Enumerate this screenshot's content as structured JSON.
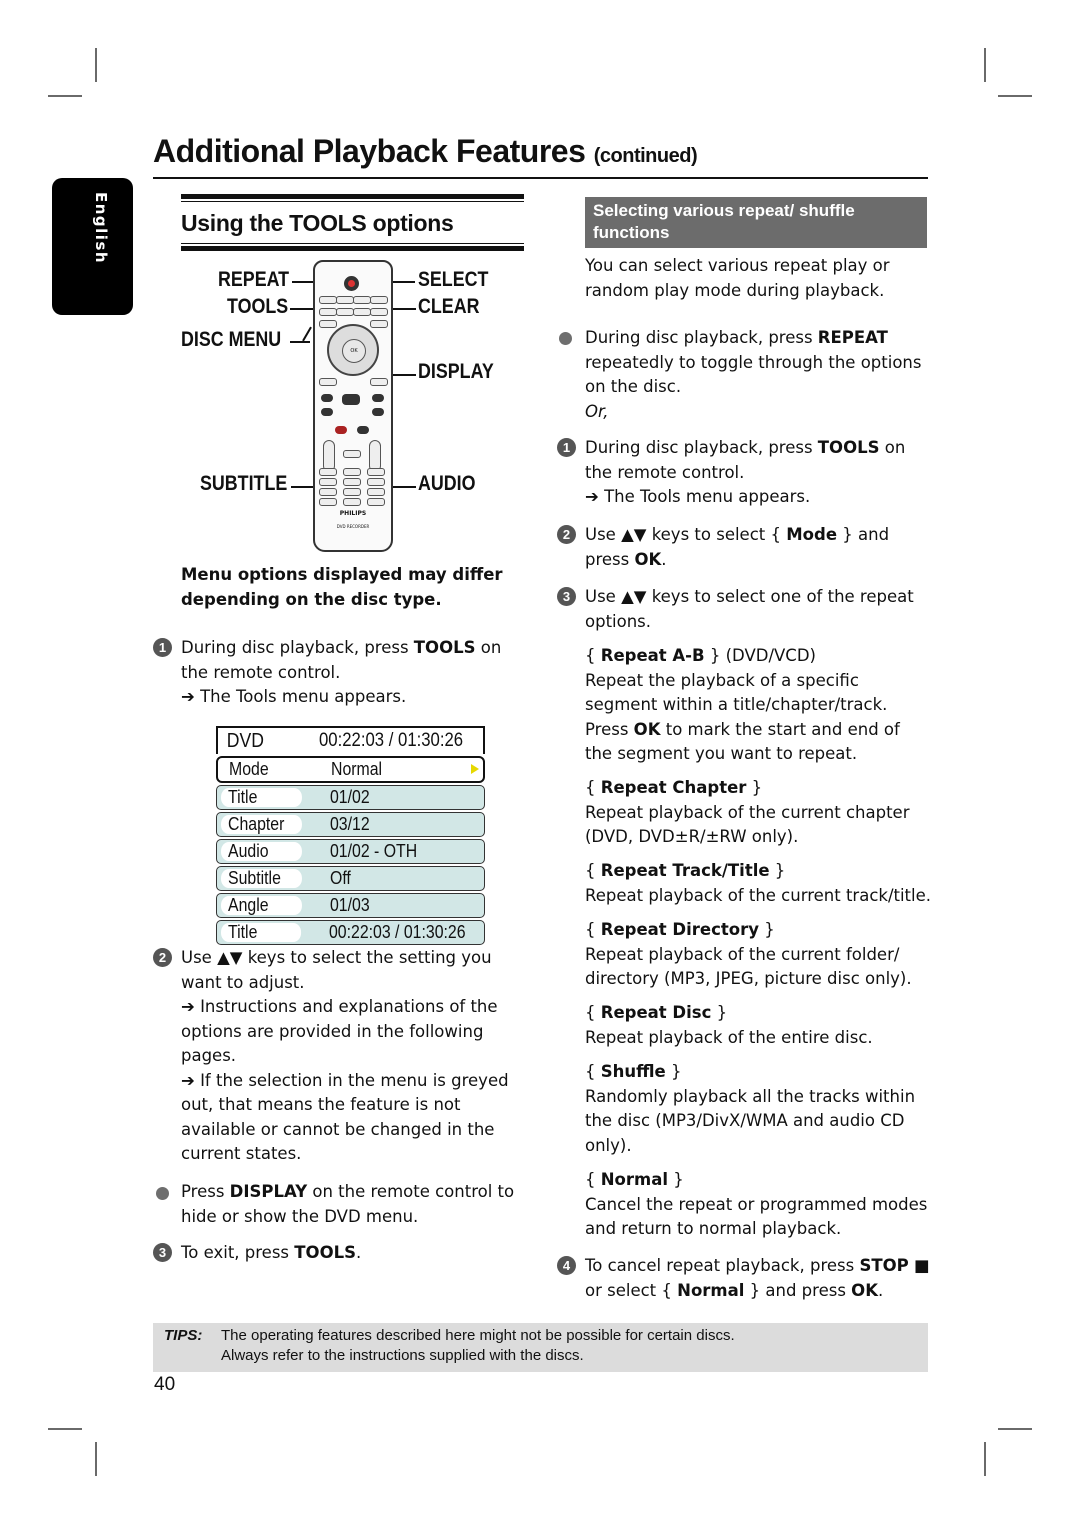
{
  "header": {
    "title": "Additional Playback Features",
    "title_suffix": "(continued)",
    "language_tab": "English"
  },
  "left": {
    "section_title": "Using the TOOLS options",
    "remote_labels": {
      "repeat": "REPEAT",
      "tools": "TOOLS",
      "disc_menu": "DISC MENU",
      "select": "SELECT",
      "clear": "CLEAR",
      "display": "DISPLAY",
      "subtitle": "SUBTITLE",
      "audio": "AUDIO"
    },
    "remote_brand": "PHILIPS",
    "remote_model": "DVD RECORDER",
    "remote_ok": "OK",
    "note": "Menu options displayed may differ depending on the disc type.",
    "step1": {
      "num": "1",
      "pre": "During disc playback, press ",
      "key": "TOOLS",
      "post": " on the remote control.",
      "result": "➔ The Tools menu appears."
    },
    "tools_menu": {
      "header_label": "DVD",
      "header_value": "00:22:03 / 01:30:26",
      "rows": [
        {
          "label": "Mode",
          "value": "Normal"
        },
        {
          "label": "Title",
          "value": "01/02"
        },
        {
          "label": "Chapter",
          "value": "03/12"
        },
        {
          "label": "Audio",
          "value": "01/02 - OTH"
        },
        {
          "label": "Subtitle",
          "value": "Off"
        },
        {
          "label": "Angle",
          "value": "01/03"
        },
        {
          "label": "Title",
          "value": "00:22:03 / 01:30:26"
        }
      ],
      "selected_highlight_color": "#ffffff",
      "row_color": "#d2e7e6",
      "arrow_color": "#e6d800"
    },
    "step2": {
      "num": "2",
      "text": "Use ▲▼ keys to select the setting you want to adjust.",
      "result1": "➔ Instructions and explanations of the options are provided in the following pages.",
      "result2": "➔ If the selection in the menu is greyed out, that means the feature is not available or cannot be changed in the current states."
    },
    "bullet": {
      "pre": "Press ",
      "key": "DISPLAY",
      "post": " on the remote control to hide or show the DVD menu."
    },
    "step3": {
      "num": "3",
      "pre": "To exit, press ",
      "key": "TOOLS",
      "post": "."
    }
  },
  "right": {
    "section_title": "Selecting various repeat/ shuffle functions",
    "intro": "You can select various repeat play or random play mode during playback.",
    "bullet": {
      "pre": "During disc playback, press ",
      "key": "REPEAT",
      "post": " repeatedly to toggle through the options on the disc.",
      "or": "Or,"
    },
    "step1": {
      "num": "1",
      "pre": "During disc playback, press ",
      "key": "TOOLS",
      "post": " on the remote control.",
      "result": "➔ The Tools menu appears."
    },
    "step2": {
      "num": "2",
      "pre": "Use ▲▼ keys to select { ",
      "key": "Mode",
      "mid": " } and press ",
      "key2": "OK",
      "post": "."
    },
    "step3": {
      "num": "3",
      "text": "Use ▲▼ keys to select one of the repeat options."
    },
    "options": [
      {
        "name": "Repeat A-B",
        "suffix": " (DVD/VCD)",
        "desc_pre": "Repeat the playback of a specific segment within a title/chapter/track. Press ",
        "desc_key": "OK",
        "desc_post": " to mark the start and end of the segment you want to repeat."
      },
      {
        "name": "Repeat Chapter",
        "suffix": "",
        "desc": "Repeat playback of the current chapter (DVD, DVD±R/±RW only)."
      },
      {
        "name": "Repeat Track/Title",
        "suffix": "",
        "desc": "Repeat playback of the current track/title."
      },
      {
        "name": "Repeat Directory",
        "suffix": "",
        "desc": "Repeat playback of the current folder/ directory (MP3, JPEG, picture disc only)."
      },
      {
        "name": "Repeat Disc",
        "suffix": "",
        "desc": "Repeat playback of the entire disc."
      },
      {
        "name": "Shuffle",
        "suffix": "",
        "desc": "Randomly playback all the tracks within the disc (MP3/DivX/WMA and audio CD only)."
      },
      {
        "name": "Normal",
        "suffix": "",
        "desc": "Cancel the repeat or programmed modes and return to normal playback."
      }
    ],
    "step4": {
      "num": "4",
      "pre": "To cancel repeat playback, press ",
      "key": "STOP",
      "mid": " ■ or select { ",
      "key2": "Normal",
      "mid2": " } and press ",
      "key3": "OK",
      "post": "."
    }
  },
  "tips": {
    "label": "TIPS:",
    "line1": "The operating features described here might not be possible for certain discs.",
    "line2": "Always refer to the instructions supplied with the discs."
  },
  "page_number": "40"
}
